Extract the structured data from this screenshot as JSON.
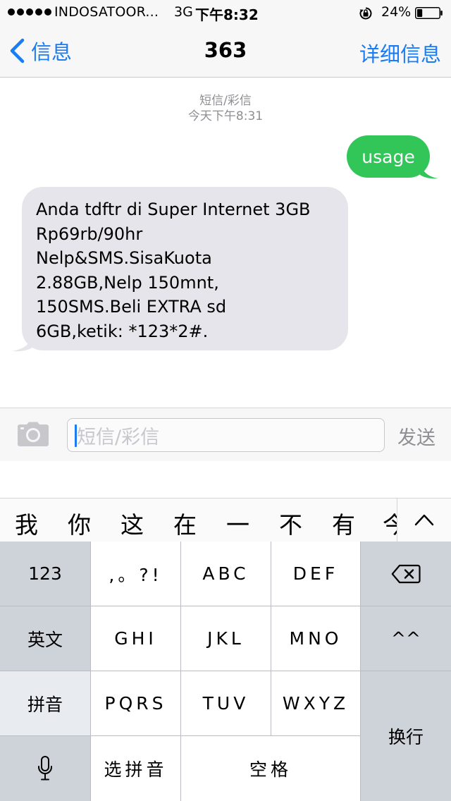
{
  "status_bar": {
    "carrier": "INDOSATOOR...",
    "network": "3G",
    "time": "下午8:32",
    "battery_percent": "24%",
    "battery_level": 0.24,
    "signal_bars": 5,
    "icons": [
      "signal-dots-icon",
      "orientation-lock-icon",
      "battery-icon"
    ]
  },
  "nav": {
    "back_label": "信息",
    "title": "363",
    "details_label": "详细信息"
  },
  "conversation": {
    "message_type": "短信/彩信",
    "timestamp": "今天下午8:31",
    "messages": [
      {
        "direction": "outgoing",
        "text": "usage",
        "color": "#32c659"
      },
      {
        "direction": "incoming",
        "text": "Anda tdftr di Super Internet 3GB\nRp69rb/90hr\nNelp&SMS.SisaKuota\n2.88GB,Nelp 150mnt,\n150SMS.Beli EXTRA sd\n6GB,ketik: *123*2#.",
        "color": "#e6e5eb"
      }
    ]
  },
  "composer": {
    "placeholder": "短信/彩信",
    "value": "",
    "send_label": "发送",
    "camera_icon": "camera-icon"
  },
  "candidates": {
    "items": [
      "我",
      "你",
      "这",
      "在",
      "一",
      "不",
      "有",
      "今"
    ],
    "expand_icon": "chevron-up-icon"
  },
  "keyboard": {
    "keys": {
      "numbers": "123",
      "punct": ",。?!",
      "abc": "ABC",
      "def": "DEF",
      "delete_icon": "delete-backspace-icon",
      "english": "英文",
      "ghi": "GHI",
      "jkl": "JKL",
      "mno": "MNO",
      "emoticon": "^^",
      "pinyin": "拼音",
      "pqrs": "PQRS",
      "tuv": "TUV",
      "wxyz": "WXYZ",
      "newline": "换行",
      "mic_icon": "microphone-icon",
      "select_pinyin": "选拼音",
      "space": "空格"
    }
  },
  "colors": {
    "ios_blue": "#1a7cf3",
    "outgoing_bubble": "#32c659",
    "incoming_bubble": "#e6e5eb",
    "keyboard_bg": "#b9bcc3",
    "dark_key": "#ced3da"
  }
}
